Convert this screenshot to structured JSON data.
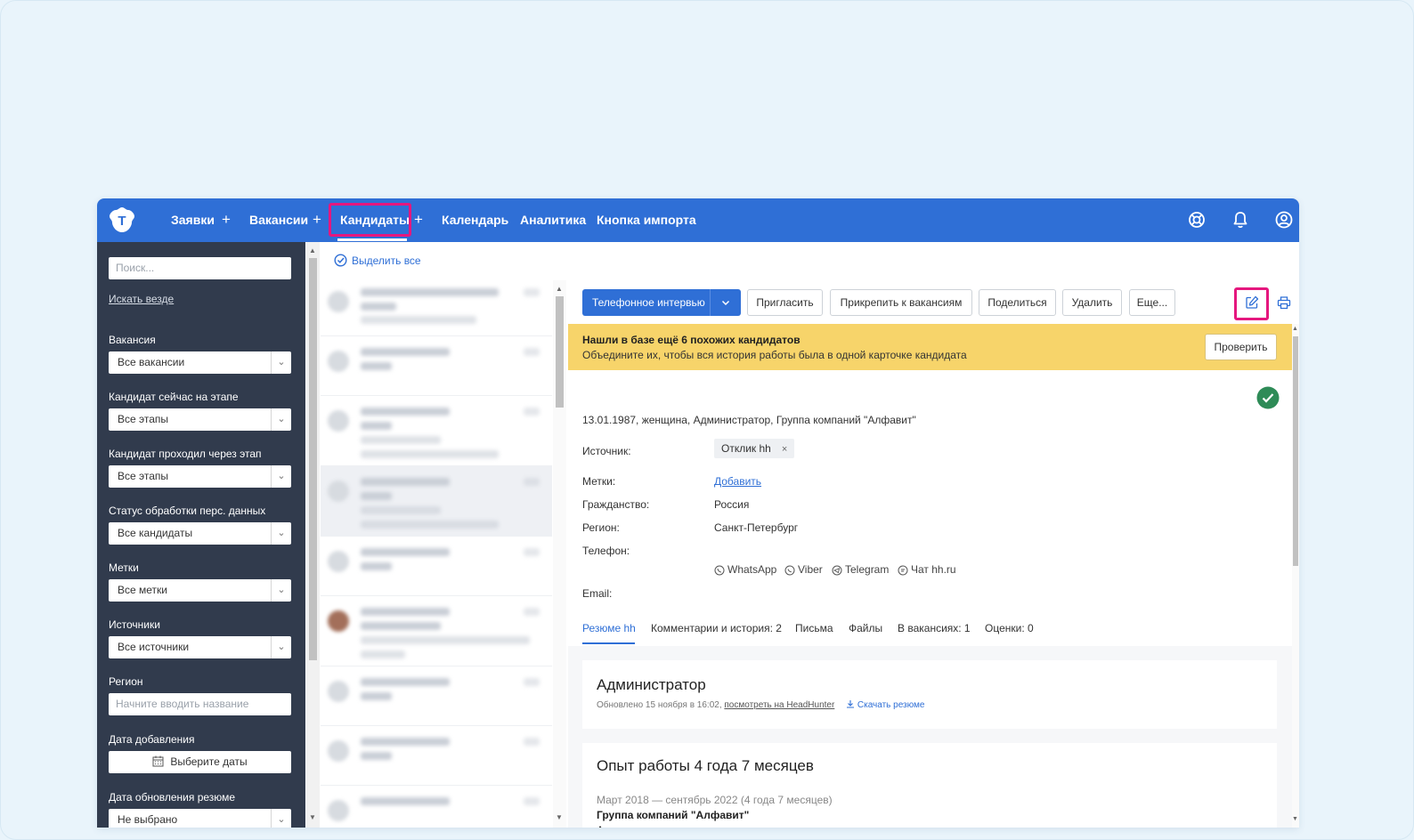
{
  "nav": {
    "items": [
      "Заявки",
      "Вакансии",
      "Кандидаты",
      "Календарь",
      "Аналитика",
      "Кнопка импорта"
    ],
    "plus": "+",
    "active_index": 2,
    "logo_letter": "T"
  },
  "sidebar": {
    "search_placeholder": "Поиск...",
    "search_everywhere": "Искать везде",
    "filters": [
      {
        "label": "Вакансия",
        "value": "Все вакансии"
      },
      {
        "label": "Кандидат сейчас на этапе",
        "value": "Все этапы"
      },
      {
        "label": "Кандидат проходил через этап",
        "value": "Все этапы"
      },
      {
        "label": "Статус обработки перс. данных",
        "value": "Все кандидаты"
      },
      {
        "label": "Метки",
        "value": "Все метки"
      },
      {
        "label": "Источники",
        "value": "Все источники"
      }
    ],
    "region_label": "Регион",
    "region_placeholder": "Начните вводить название",
    "date_added_label": "Дата добавления",
    "date_button": "Выберите даты",
    "resume_update_label": "Дата обновления резюме",
    "resume_update_value": "Не выбрано"
  },
  "list": {
    "select_all": "Выделить все"
  },
  "toolbar": {
    "primary": "Телефонное интервью",
    "buttons": [
      "Пригласить",
      "Прикрепить к вакансиям",
      "Поделиться",
      "Удалить",
      "Еще..."
    ]
  },
  "banner": {
    "title": "Нашли в базе ещё 6 похожих кандидатов",
    "text": "Объедините их, чтобы вся история работы была в одной карточке кандидата",
    "button": "Проверить"
  },
  "candidate": {
    "summary": "13.01.1987, женщина, Администратор, Группа компаний \"Алфавит\"",
    "source_label": "Источник:",
    "source_chip": "Отклик hh",
    "chip_close": "×",
    "tags_label": "Метки:",
    "tags_add": "Добавить",
    "citizenship_label": "Гражданство:",
    "citizenship": "Россия",
    "region_label": "Регион:",
    "region": "Санкт-Петербург",
    "phone_label": "Телефон:",
    "messengers": [
      "WhatsApp",
      "Viber",
      "Telegram",
      "Чат hh.ru"
    ],
    "email_label": "Email:"
  },
  "tabs": [
    "Резюме hh",
    "Комментарии и история: 2",
    "Письма",
    "Файлы",
    "В вакансиях: 1",
    "Оценки: 0"
  ],
  "resume": {
    "title": "Администратор",
    "updated": "Обновлено 15 ноября в 16:02,",
    "hh_link": "посмотреть на HeadHunter",
    "download": "Скачать резюме"
  },
  "experience": {
    "title": "Опыт работы 4 года 7 месяцев",
    "period": "Март 2018 — сентябрь 2022 (4 года 7 месяцев)",
    "company": "Группа компаний \"Алфавит\"",
    "role": "Администратор"
  },
  "colors": {
    "brand": "#2f6fd6",
    "highlight": "#e5177e",
    "sidebar": "#313b4d",
    "banner": "#f7d46a",
    "success": "#2e8b57"
  }
}
